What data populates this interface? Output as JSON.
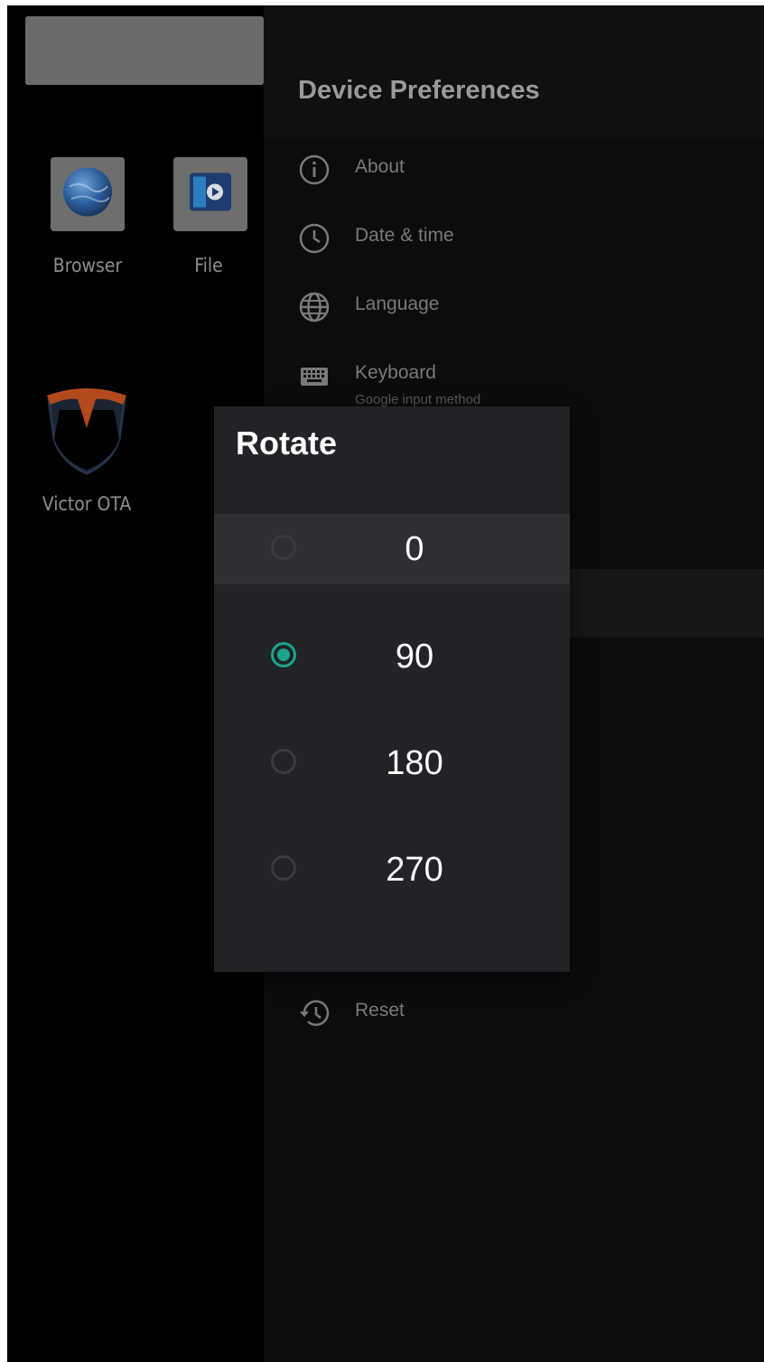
{
  "launcher": {
    "apps": [
      {
        "label": "Browser",
        "icon": "globe-icon"
      },
      {
        "label": "File",
        "icon": "file-player-icon"
      },
      {
        "label": "Victor OTA",
        "icon": "victor-shield-logo"
      }
    ]
  },
  "settings": {
    "title": "Device Preferences",
    "items": [
      {
        "label": "About",
        "icon": "info-icon"
      },
      {
        "label": "Date & time",
        "icon": "clock-icon"
      },
      {
        "label": "Language",
        "icon": "globe-icon"
      },
      {
        "label": "Keyboard",
        "sublabel": "Google input method",
        "icon": "keyboard-icon"
      },
      {
        "label": "Reset",
        "icon": "reset-history-icon"
      }
    ]
  },
  "dialog": {
    "title": "Rotate",
    "options": [
      {
        "label": "0",
        "checked": false,
        "focused": true
      },
      {
        "label": "90",
        "checked": true,
        "focused": false
      },
      {
        "label": "180",
        "checked": false,
        "focused": false
      },
      {
        "label": "270",
        "checked": false,
        "focused": false
      }
    ]
  },
  "colors": {
    "accent": "#1aa58c",
    "dialog_bg": "#222327",
    "victor_orange": "#b34a1c"
  }
}
